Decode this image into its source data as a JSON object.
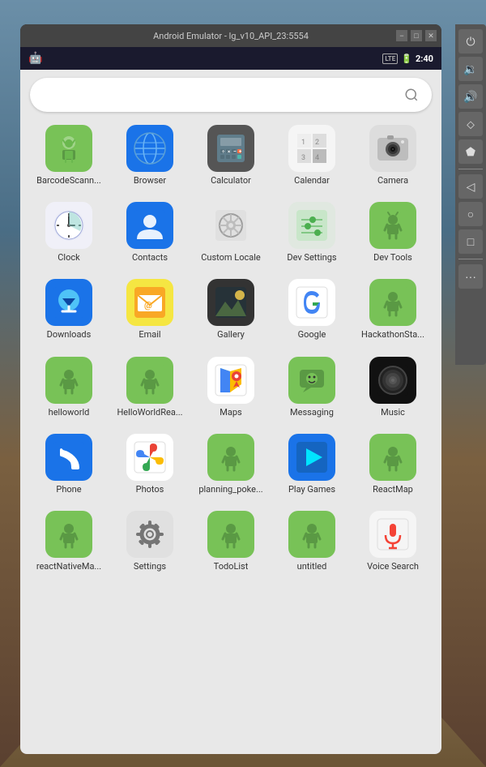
{
  "window": {
    "title": "Android Emulator - lg_v10_API_23:5554",
    "min_btn": "−",
    "max_btn": "□",
    "close_btn": "✕"
  },
  "status_bar": {
    "lte": "LTE",
    "time": "2:40",
    "icons": [
      "battery",
      "signal"
    ]
  },
  "search": {
    "placeholder": "",
    "icon": "🔍"
  },
  "apps": [
    {
      "label": "BarcodeScann...",
      "type": "android",
      "icon_type": "android"
    },
    {
      "label": "Browser",
      "icon_type": "browser"
    },
    {
      "label": "Calculator",
      "icon_type": "calculator"
    },
    {
      "label": "Calendar",
      "icon_type": "calendar"
    },
    {
      "label": "Camera",
      "icon_type": "camera"
    },
    {
      "label": "Clock",
      "icon_type": "clock"
    },
    {
      "label": "Contacts",
      "icon_type": "contacts"
    },
    {
      "label": "Custom Locale",
      "icon_type": "custom-locale"
    },
    {
      "label": "Dev Settings",
      "icon_type": "dev-settings"
    },
    {
      "label": "Dev Tools",
      "icon_type": "dev-tools"
    },
    {
      "label": "Downloads",
      "icon_type": "downloads"
    },
    {
      "label": "Email",
      "icon_type": "email"
    },
    {
      "label": "Gallery",
      "icon_type": "gallery"
    },
    {
      "label": "Google",
      "icon_type": "google"
    },
    {
      "label": "HackathonSta...",
      "icon_type": "hackathon"
    },
    {
      "label": "helloworld",
      "icon_type": "helloworld"
    },
    {
      "label": "HelloWorldRea...",
      "icon_type": "helloworld2"
    },
    {
      "label": "Maps",
      "icon_type": "maps"
    },
    {
      "label": "Messaging",
      "icon_type": "messaging"
    },
    {
      "label": "Music",
      "icon_type": "music"
    },
    {
      "label": "Phone",
      "icon_type": "phone"
    },
    {
      "label": "Photos",
      "icon_type": "photos"
    },
    {
      "label": "planning_poke...",
      "icon_type": "planning"
    },
    {
      "label": "Play Games",
      "icon_type": "playgames"
    },
    {
      "label": "ReactMap",
      "icon_type": "reactmap"
    },
    {
      "label": "reactNativeMa...",
      "icon_type": "reactnative"
    },
    {
      "label": "Settings",
      "icon_type": "settings"
    },
    {
      "label": "TodoList",
      "icon_type": "todolist"
    },
    {
      "label": "untitled",
      "icon_type": "untitled"
    },
    {
      "label": "Voice Search",
      "icon_type": "voicesearch"
    }
  ],
  "side_panel": {
    "buttons": [
      "⏻",
      "🔇",
      "🔊",
      "✦",
      "⬟",
      "◁",
      "○",
      "□",
      "···"
    ]
  }
}
